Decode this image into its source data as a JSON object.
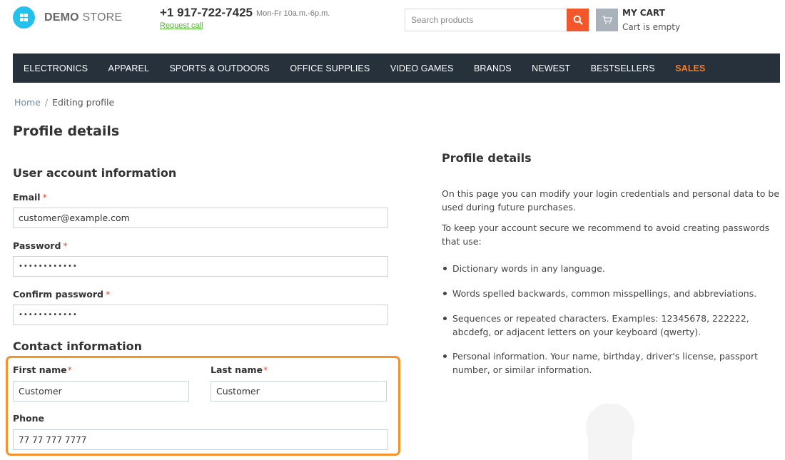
{
  "header": {
    "logo_bold": "DEMO",
    "logo_light": " STORE",
    "phone": "+1 917-722-7425",
    "hours": "Mon-Fr 10a.m.-6p.m.",
    "request_call": "Request call",
    "search_placeholder": "Search products",
    "cart_title": "MY CART",
    "cart_status": "Cart is empty"
  },
  "nav": {
    "items": [
      "ELECTRONICS",
      "APPAREL",
      "SPORTS & OUTDOORS",
      "OFFICE SUPPLIES",
      "VIDEO GAMES",
      "BRANDS",
      "NEWEST",
      "BESTSELLERS",
      "SALES"
    ]
  },
  "breadcrumb": {
    "home": "Home",
    "separator": "/",
    "current": "Editing profile"
  },
  "page": {
    "title": "Profile details"
  },
  "account": {
    "title": "User account information",
    "email_label": "Email",
    "email_value": "customer@example.com",
    "password_label": "Password",
    "password_value": "••••••••••••",
    "confirm_label": "Confirm password",
    "confirm_value": "••••••••••••",
    "required_mark": "*"
  },
  "contact": {
    "title": "Contact information",
    "first_name_label": "First name",
    "first_name_value": "Customer",
    "last_name_label": "Last name",
    "last_name_value": "Customer",
    "phone_label": "Phone",
    "phone_value": "77 77 777 7777"
  },
  "sidebar": {
    "title": "Profile details",
    "intro": "On this page you can modify your login credentials and personal data to be used during future purchases.",
    "secure": "To keep your account secure we recommend to avoid creating passwords that use:",
    "bullets": [
      "Dictionary words in any language.",
      "Words spelled backwards, common misspellings, and abbreviations.",
      "Sequences or repeated characters. Examples: 12345678, 222222, abcdefg, or adjacent letters on your keyboard (qwerty).",
      "Personal information. Your name, birthday, driver's license, passport number, or similar information."
    ]
  },
  "colors": {
    "accent_search": "#f2562b",
    "nav_bg": "#26313b",
    "sales": "#ff7a1a",
    "highlight": "#f5922b",
    "logo": "#24c1ee"
  },
  "icons": {
    "logo": "logo-icon",
    "search": "search-icon",
    "cart": "cart-icon",
    "avatar": "avatar-icon"
  }
}
